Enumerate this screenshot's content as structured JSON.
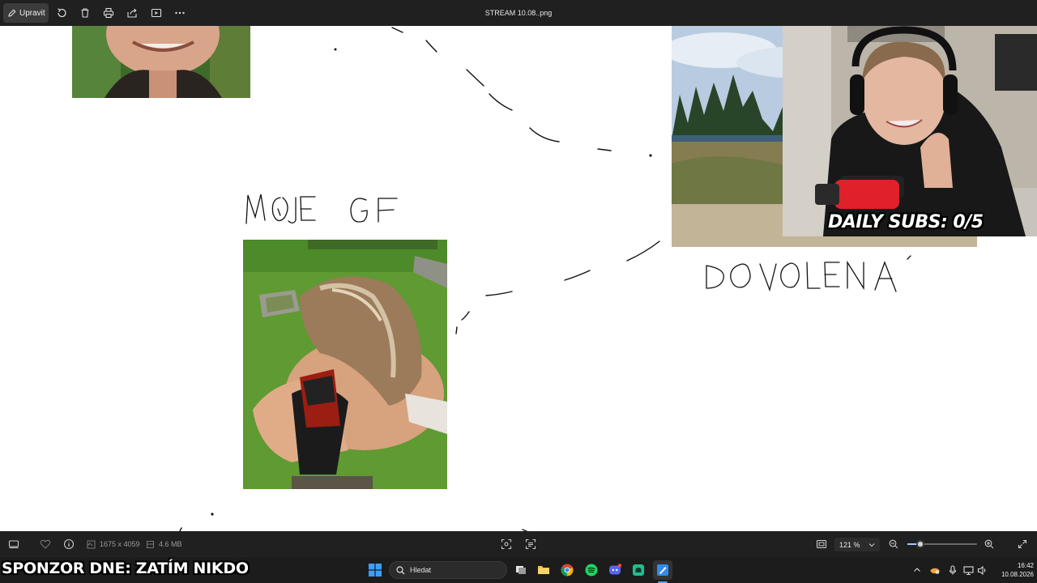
{
  "toolbar": {
    "edit_label": "Upravit",
    "title": "STREAM 10.08..png",
    "icons": [
      "pencil-icon",
      "rotate-icon",
      "delete-icon",
      "print-icon",
      "share-icon",
      "slideshow-icon",
      "more-icon"
    ]
  },
  "canvas": {
    "handwriting": [
      {
        "text": "MOJE GF"
      },
      {
        "text": "DOVOLENÁ"
      }
    ]
  },
  "webcam": {
    "overlay_text": "DAILY SUBS: 0/5"
  },
  "bottombar": {
    "dimensions": "1675 x 4059",
    "file_size": "4.6 MB",
    "zoom": "121 %",
    "zoom_level": 0.19
  },
  "taskbar": {
    "overlay_text": "SPONZOR DNE: ZATÍM NIKDO",
    "search_placeholder": "Hledat",
    "time": "16:42",
    "date": "10.08.2026",
    "apps": [
      "windows-start-icon",
      "task-view-icon",
      "file-explorer-icon",
      "chrome-icon",
      "spotify-icon",
      "discord-icon",
      "android-app-icon",
      "paint-app-icon"
    ]
  },
  "colors": {
    "chrome_dark": "#202020",
    "taskbar": "#1c1c1c",
    "accent": "#4aa3ff"
  }
}
